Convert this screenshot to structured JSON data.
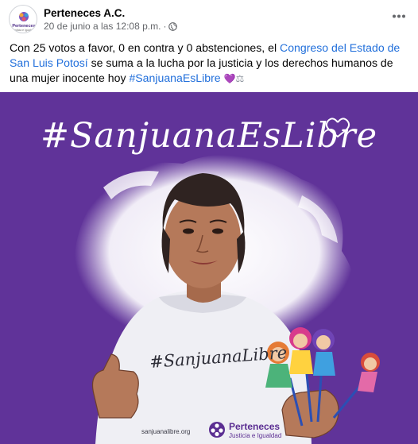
{
  "post": {
    "author": "Perteneces A.C.",
    "date": "20 de junio a las 12:08 p.m.",
    "separator": "·",
    "text_intro": "Con 25 votos a favor, 0 en contra y 0 abstenciones, el ",
    "text_link": "Congreso del Estado de San Luis Potosí",
    "text_middle": " se suma a la lucha por la justicia y los derechos humanos de una mujer inocente hoy ",
    "hashtag": "#SanjuanaEsLibre",
    "emoji_heart": "💜",
    "emoji_scale": "⚖"
  },
  "avatar": {
    "name": "Perteneces",
    "tagline": "Justicia e Igualdad"
  },
  "image": {
    "title": "#SanjuanaEsLibre",
    "shirt_text": "#SanjuanaLibre",
    "website": "sanjuanalibre.org",
    "org_name": "Perteneces",
    "org_tagline": "Justicia e Igualdad"
  },
  "icons": {
    "privacy": "globe-icon",
    "menu": "more-options-icon"
  },
  "colors": {
    "link": "#216fdb",
    "purple": "#5b2e92",
    "meta": "#65676b"
  }
}
